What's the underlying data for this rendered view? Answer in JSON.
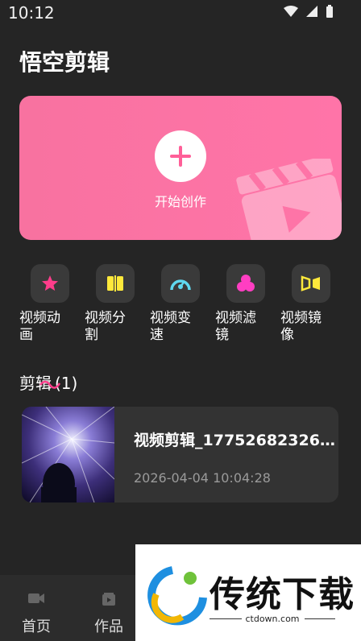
{
  "status_bar": {
    "time": "10:12"
  },
  "app": {
    "title": "悟空剪辑"
  },
  "hero": {
    "label": "开始创作",
    "color": "#ff74a8"
  },
  "tools": [
    {
      "label": "视频动画",
      "icon": "star-icon",
      "color": "#ff3d8b"
    },
    {
      "label": "视频分割",
      "icon": "split-icon",
      "color": "#ffe93b"
    },
    {
      "label": "视频变速",
      "icon": "speedometer-icon",
      "color": "#5fd8ef"
    },
    {
      "label": "视频滤镜",
      "icon": "filter-icon",
      "color": "#ff3ec2"
    },
    {
      "label": "视频镜像",
      "icon": "mirror-icon",
      "color": "#ffe93b"
    }
  ],
  "projects_section": {
    "title": "剪辑",
    "count": "(1)"
  },
  "project": {
    "name": "视频剪辑_17752682326...",
    "date": "2026-04-04 10:04:28"
  },
  "bottom_nav": [
    {
      "label": "首页",
      "icon": "camera-icon"
    },
    {
      "label": "作品",
      "icon": "works-icon"
    }
  ],
  "watermark": {
    "text": "传统下载",
    "url": "ctdown.com"
  }
}
